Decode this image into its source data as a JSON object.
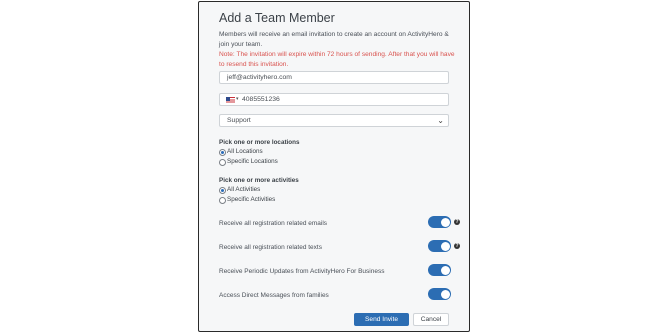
{
  "dialog": {
    "title": "Add a Team Member",
    "description": "Members will receive an email invitation to create an account on ActivityHero & join your team.",
    "note": "Note: The invitation will expire within 72 hours of sending. After that you will have to resend this invitation."
  },
  "form": {
    "email": {
      "value": "jeff@activityhero.com"
    },
    "phone": {
      "country_flag": "us-flag-icon",
      "value": "4085551236"
    },
    "role": {
      "selected": "Support"
    }
  },
  "locations": {
    "heading": "Pick one or more locations",
    "options": [
      {
        "label": "All Locations",
        "selected": true
      },
      {
        "label": "Specific Locations",
        "selected": false
      }
    ]
  },
  "activities": {
    "heading": "Pick one or more activities",
    "options": [
      {
        "label": "All Activities",
        "selected": true
      },
      {
        "label": "Specific Activities",
        "selected": false
      }
    ]
  },
  "toggles": [
    {
      "label": "Receive all registration related emails",
      "on": true,
      "help": "?"
    },
    {
      "label": "Receive all registration related texts",
      "on": true,
      "help": "?"
    },
    {
      "label": "Receive Periodic Updates from ActivityHero For Business",
      "on": true
    },
    {
      "label": "Access Direct Messages from families",
      "on": true
    }
  ],
  "actions": {
    "send_label": "Send Invite",
    "cancel_label": "Cancel"
  },
  "colors": {
    "accent": "#2c6db3",
    "note": "#d9534f"
  }
}
